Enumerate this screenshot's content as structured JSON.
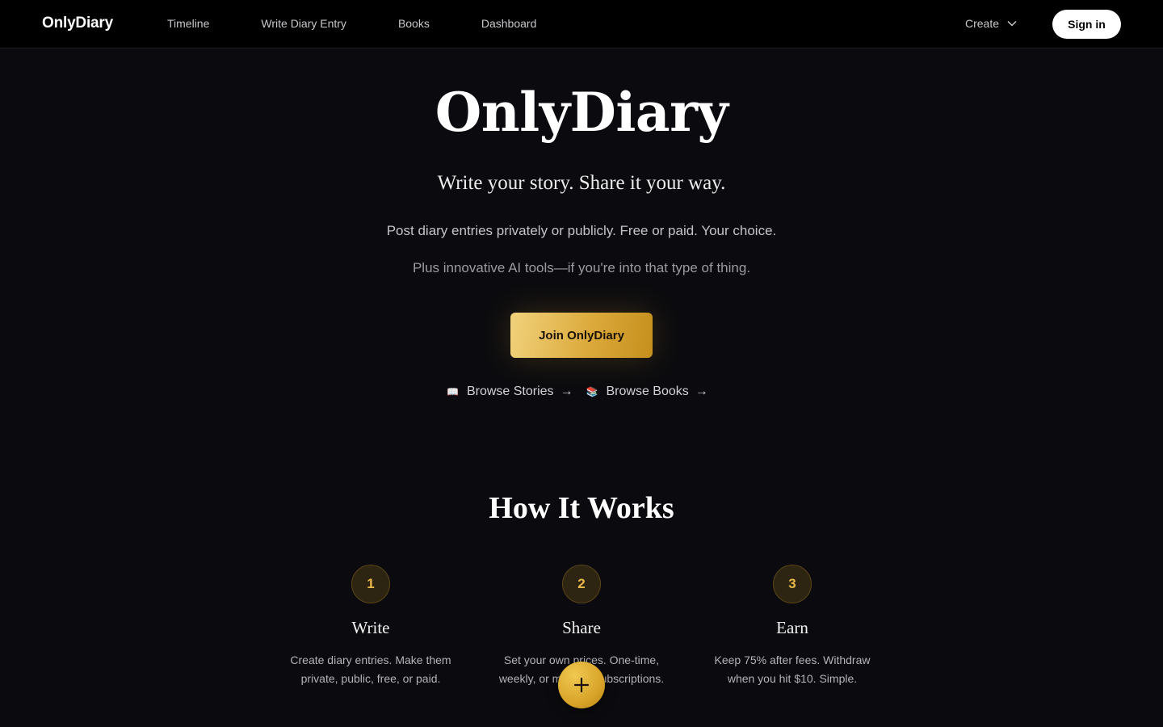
{
  "nav": {
    "brand": "OnlyDiary",
    "links": [
      {
        "label": "Timeline"
      },
      {
        "label": "Write Diary Entry"
      },
      {
        "label": "Books"
      },
      {
        "label": "Dashboard"
      }
    ],
    "create_label": "Create",
    "create_icon": "chevron-down-icon",
    "signin_label": "Sign in"
  },
  "hero": {
    "title": "OnlyDiary",
    "subtitle": "Write your story. Share it your way.",
    "description": "Post diary entries privately or publicly. Free or paid. Your choice.",
    "description2": "Plus innovative AI tools—if you're into that type of thing.",
    "cta_label": "Join OnlyDiary",
    "browse": [
      {
        "icon": "📖",
        "icon_name": "open-book-icon",
        "label": "Browse Stories",
        "arrow": "→"
      },
      {
        "icon": "📚",
        "icon_name": "books-icon",
        "label": "Browse Books",
        "arrow": "→"
      }
    ]
  },
  "how_it_works": {
    "title": "How It Works",
    "steps": [
      {
        "number": "1",
        "title": "Write",
        "description": "Create diary entries. Make them private, public, free, or paid."
      },
      {
        "number": "2",
        "title": "Share",
        "description": "Set your own prices. One-time, weekly, or monthly subscriptions."
      },
      {
        "number": "3",
        "title": "Earn",
        "description": "Keep 75% after fees. Withdraw when you hit $10. Simple."
      }
    ]
  },
  "fab": {
    "icon": "plus-icon"
  },
  "colors": {
    "background": "#0b0b0f",
    "navbar": "#000000",
    "accent_gold": "#dcaa3c",
    "step_number": "#e9b949"
  }
}
